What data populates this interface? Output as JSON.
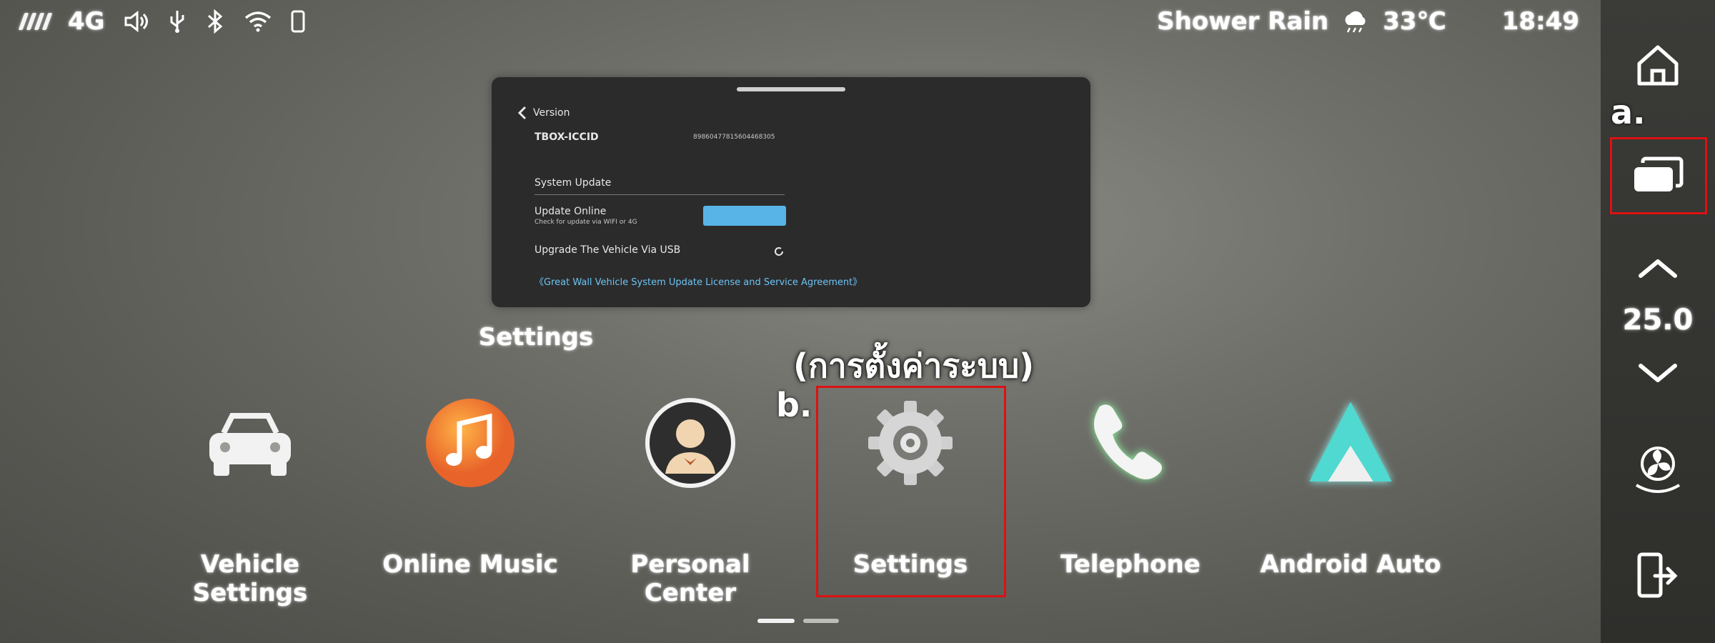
{
  "status_bar": {
    "network": "4G",
    "weather_text": "Shower Rain",
    "temperature": "33℃",
    "time": "18:49",
    "icons": [
      "signal-icon",
      "volume-icon",
      "usb-icon",
      "bluetooth-icon",
      "wifi-icon",
      "phone-icon",
      "weather-cloud-icon"
    ]
  },
  "preview_card": {
    "back_label": "Version",
    "tbox_label": "TBOX-ICCID",
    "tbox_value": "89860477815604468305",
    "section_title": "System Update",
    "update_online_title": "Update Online",
    "update_online_desc": "Check for update via WIFI or 4G",
    "usb_upgrade": "Upgrade The Vehicle Via USB",
    "agreement_link": "《Great Wall Vehicle System Update License and Service Agreement》"
  },
  "preview_label": "Settings",
  "annotations": {
    "thai_caption": "(การตั้งค่าระบบ)",
    "marker_a": "a.",
    "marker_b": "b."
  },
  "apps": [
    {
      "label": "Vehicle Settings",
      "icon": "car-icon"
    },
    {
      "label": "Online Music",
      "icon": "music-note-icon"
    },
    {
      "label": "Personal Center",
      "icon": "person-icon"
    },
    {
      "label": "Settings",
      "icon": "gear-icon"
    },
    {
      "label": "Telephone",
      "icon": "phone-handset-icon"
    },
    {
      "label": "Android Auto",
      "icon": "android-auto-icon"
    }
  ],
  "rail": {
    "icons": [
      "home-icon",
      "recent-apps-icon",
      "chevron-up-icon",
      "chevron-down-icon",
      "fan-icon",
      "exit-icon"
    ],
    "climate_value": "25.0"
  },
  "pager": {
    "pages": 2,
    "current": 1
  },
  "colors": {
    "highlight": "#dd1111",
    "accent_blue": "#58b4e6",
    "android_teal": "#4fd9d0"
  }
}
